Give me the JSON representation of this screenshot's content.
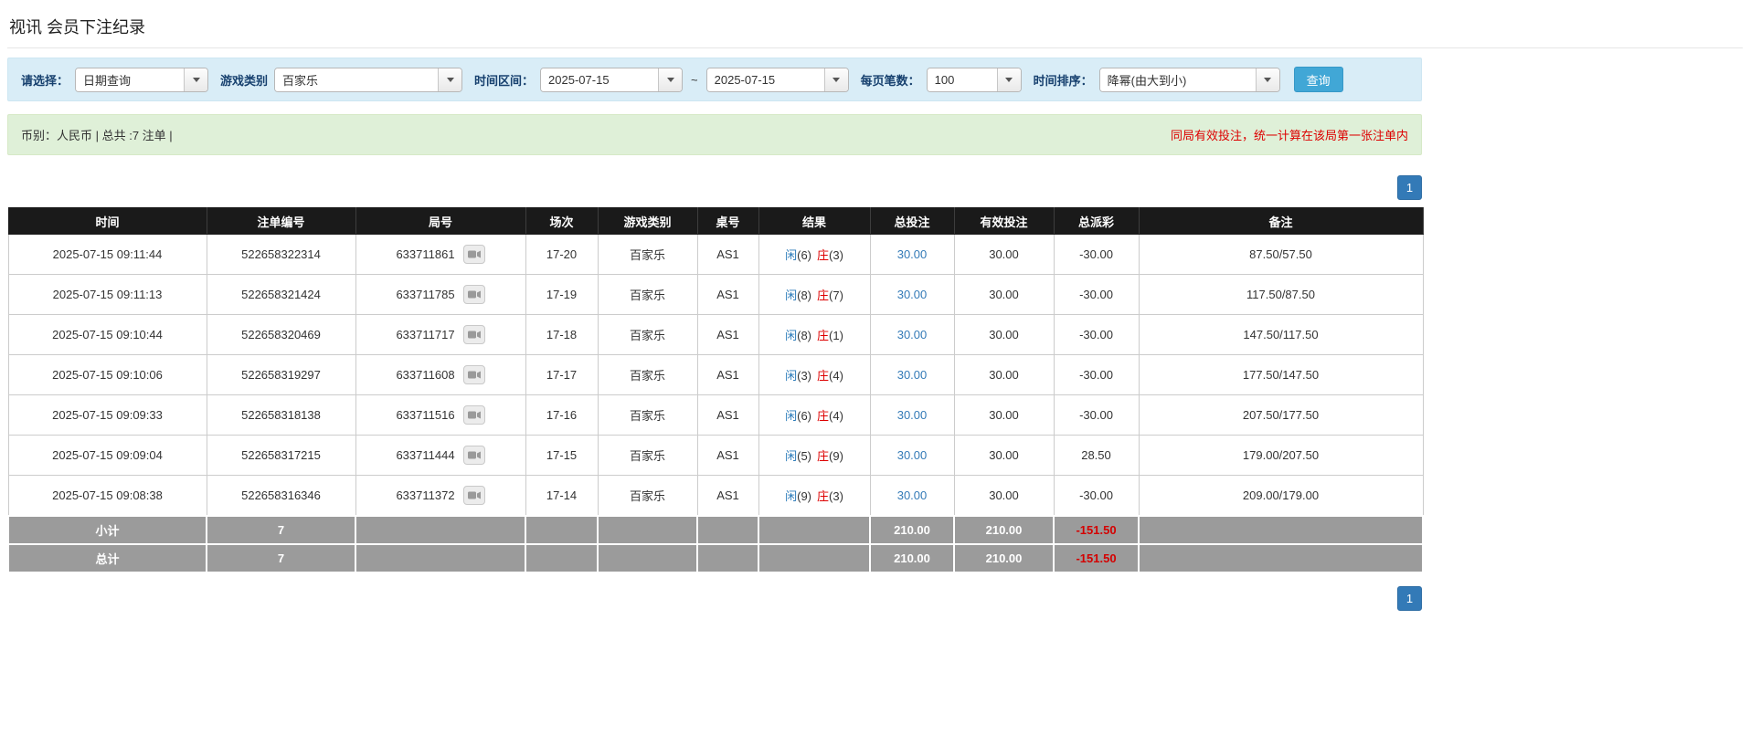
{
  "page": {
    "title": "视讯 会员下注纪录"
  },
  "filters": {
    "select_label": "请选择：",
    "select_value": "日期查询",
    "game_type_label": "游戏类别",
    "game_type_value": "百家乐",
    "range_label": "时间区间：",
    "date_from": "2025-07-15",
    "range_separator": "~",
    "date_to": "2025-07-15",
    "page_size_label": "每页笔数：",
    "page_size_value": "100",
    "sort_label": "时间排序：",
    "sort_value": "降幂(由大到小)",
    "search_button_label": "查询"
  },
  "summary_bar": {
    "left_text": "币别：人民币 | 总共 :7 注单 |",
    "right_notice": "同局有效投注，统一计算在该局第一张注单内"
  },
  "pagination": {
    "current_page": "1"
  },
  "colors": {
    "filter_bar_bg": "#d9edf7",
    "summary_bar_bg": "#dff0d8",
    "notice_red": "#dd0000",
    "negative_red": "#dd0000",
    "link_blue": "#337ab7",
    "player_blue": "#2a7ab9",
    "banker_red": "#dd0000",
    "header_bg": "#1a1a1a",
    "footer_row_bg": "#9b9b9b",
    "highlight_row_bg": "#ffffb8",
    "search_button_bg": "#41a7d6",
    "pager_button_bg": "#337ab7"
  },
  "table": {
    "headers": [
      "时间",
      "注单编号",
      "局号",
      "场次",
      "游戏类别",
      "桌号",
      "结果",
      "总投注",
      "有效投注",
      "总派彩",
      "备注"
    ],
    "rows": [
      {
        "time": "2025-07-15 09:11:44",
        "bet_id": "522658322314",
        "round_id": "633711861",
        "session": "17-20",
        "game_type": "百家乐",
        "table_no": "AS1",
        "result": {
          "player": "闲",
          "player_score": "(6)",
          "banker": "庄",
          "banker_score": "(3)"
        },
        "total_bet": "30.00",
        "valid_bet": "30.00",
        "payout": "-30.00",
        "remark": "87.50/57.50"
      },
      {
        "time": "2025-07-15 09:11:13",
        "bet_id": "522658321424",
        "round_id": "633711785",
        "session": "17-19",
        "game_type": "百家乐",
        "table_no": "AS1",
        "result": {
          "player": "闲",
          "player_score": "(8)",
          "banker": "庄",
          "banker_score": "(7)"
        },
        "total_bet": "30.00",
        "valid_bet": "30.00",
        "payout": "-30.00",
        "remark": "117.50/87.50"
      },
      {
        "time": "2025-07-15 09:10:44",
        "bet_id": "522658320469",
        "round_id": "633711717",
        "session": "17-18",
        "game_type": "百家乐",
        "table_no": "AS1",
        "result": {
          "player": "闲",
          "player_score": "(8)",
          "banker": "庄",
          "banker_score": "(1)"
        },
        "total_bet": "30.00",
        "valid_bet": "30.00",
        "payout": "-30.00",
        "remark": "147.50/117.50"
      },
      {
        "time": "2025-07-15 09:10:06",
        "bet_id": "522658319297",
        "round_id": "633711608",
        "session": "17-17",
        "game_type": "百家乐",
        "table_no": "AS1",
        "result": {
          "player": "闲",
          "player_score": "(3)",
          "banker": "庄",
          "banker_score": "(4)"
        },
        "total_bet": "30.00",
        "valid_bet": "30.00",
        "payout": "-30.00",
        "remark": "177.50/147.50"
      },
      {
        "time": "2025-07-15 09:09:33",
        "bet_id": "522658318138",
        "round_id": "633711516",
        "session": "17-16",
        "game_type": "百家乐",
        "table_no": "AS1",
        "result": {
          "player": "闲",
          "player_score": "(6)",
          "banker": "庄",
          "banker_score": "(4)"
        },
        "total_bet": "30.00",
        "valid_bet": "30.00",
        "payout": "-30.00",
        "remark": "207.50/177.50"
      },
      {
        "time": "2025-07-15 09:09:04",
        "bet_id": "522658317215",
        "round_id": "633711444",
        "session": "17-15",
        "game_type": "百家乐",
        "table_no": "AS1",
        "result": {
          "player": "闲",
          "player_score": "(5)",
          "banker": "庄",
          "banker_score": "(9)"
        },
        "total_bet": "30.00",
        "valid_bet": "30.00",
        "payout": "28.50",
        "remark": "179.00/207.50"
      },
      {
        "time": "2025-07-15 09:08:38",
        "bet_id": "522658316346",
        "round_id": "633711372",
        "session": "17-14",
        "game_type": "百家乐",
        "table_no": "AS1",
        "result": {
          "player": "闲",
          "player_score": "(9)",
          "banker": "庄",
          "banker_score": "(3)"
        },
        "total_bet": "30.00",
        "valid_bet": "30.00",
        "payout": "-30.00",
        "remark": "209.00/179.00"
      }
    ],
    "subtotal_row": {
      "label": "小计",
      "count": "7",
      "total_bet": "210.00",
      "valid_bet": "210.00",
      "payout": "-151.50"
    },
    "total_row": {
      "label": "总计",
      "count": "7",
      "total_bet": "210.00",
      "valid_bet": "210.00",
      "payout": "-151.50"
    }
  }
}
